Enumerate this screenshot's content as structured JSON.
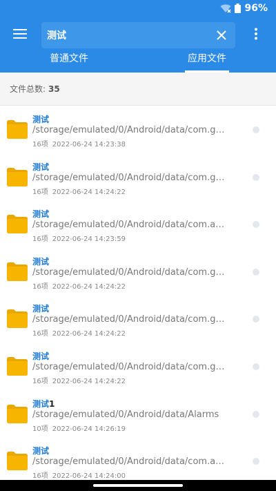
{
  "status_bar": {
    "battery": "96%"
  },
  "search": {
    "query": "测试"
  },
  "tabs": [
    {
      "label": "普通文件",
      "active": false
    },
    {
      "label": "应用文件",
      "active": true
    }
  ],
  "summary": {
    "label": "文件总数:",
    "count": "35"
  },
  "items": [
    {
      "title": "测试",
      "title_suffix": "",
      "path": "/storage/emulated/0/Android/data/com.go...",
      "count": "16项",
      "date": "2022-06-24 14:23:38"
    },
    {
      "title": "测试",
      "title_suffix": "",
      "path": "/storage/emulated/0/Android/data/com.go...",
      "count": "16项",
      "date": "2022-06-24 14:24:22"
    },
    {
      "title": "测试",
      "title_suffix": "",
      "path": "/storage/emulated/0/Android/data/com.an...",
      "count": "16项",
      "date": "2022-06-24 14:23:59"
    },
    {
      "title": "测试",
      "title_suffix": "",
      "path": "/storage/emulated/0/Android/data/com.go...",
      "count": "16项",
      "date": "2022-06-24 14:24:22"
    },
    {
      "title": "测试",
      "title_suffix": "",
      "path": "/storage/emulated/0/Android/data/com.go...",
      "count": "16项",
      "date": "2022-06-24 14:24:22"
    },
    {
      "title": "测试",
      "title_suffix": "",
      "path": "/storage/emulated/0/Android/data/com.go...",
      "count": "16项",
      "date": "2022-06-24 14:24:22"
    },
    {
      "title": "测试",
      "title_suffix": "1",
      "path": "/storage/emulated/0/Android/data/Alarms",
      "count": "10项",
      "date": "2022-06-24 14:26:19"
    },
    {
      "title": "测试",
      "title_suffix": "",
      "path": "/storage/emulated/0/Android/data/com.an...",
      "count": "16项",
      "date": "2022-06-24 14:24:00"
    }
  ],
  "colors": {
    "primary": "#2b8ae6",
    "folder": "#f7b500",
    "title": "#1e7ad6"
  },
  "icons": {
    "wifi": "wifi-off-icon",
    "battery": "battery-icon",
    "menu": "hamburger-menu-icon",
    "clear": "close-icon",
    "more": "more-vertical-icon",
    "folder": "folder-icon"
  }
}
